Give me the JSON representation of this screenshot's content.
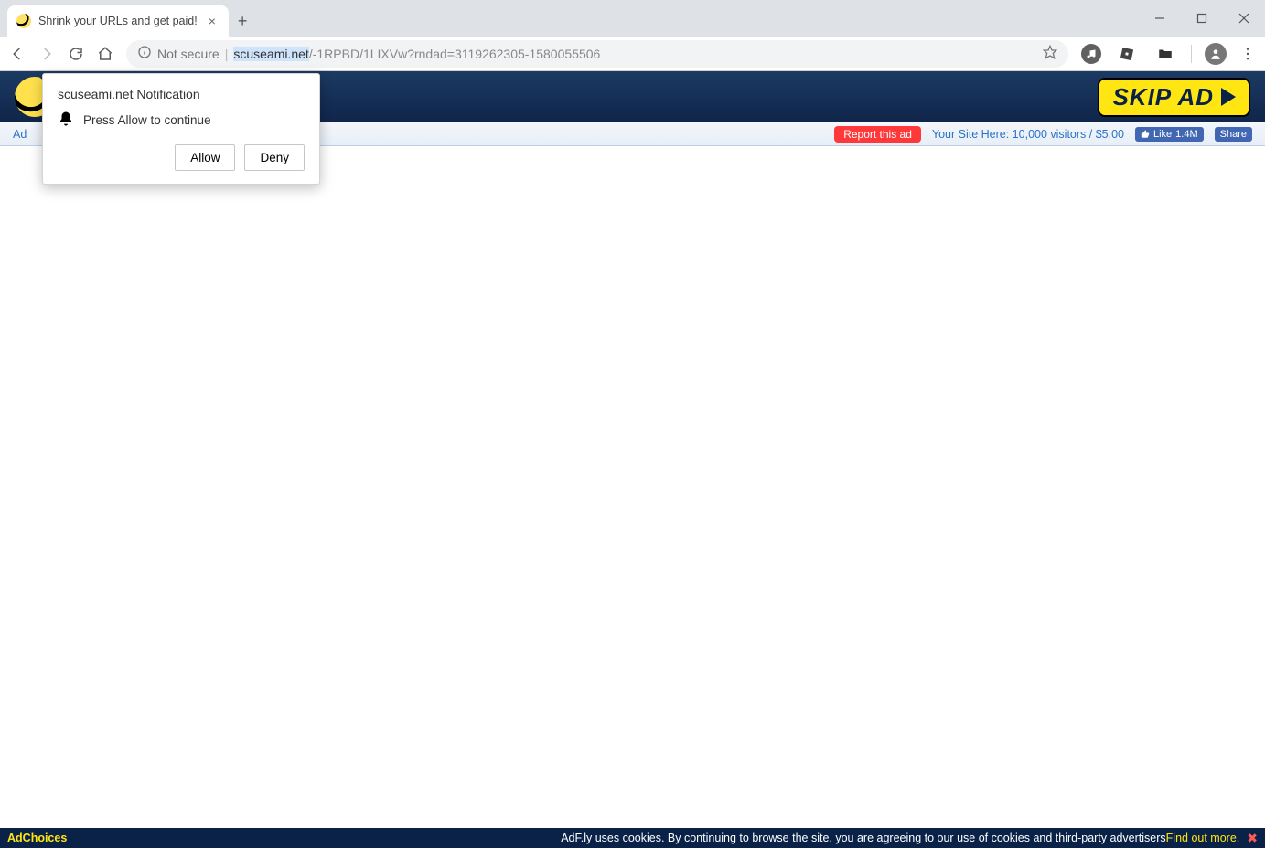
{
  "chrome": {
    "tab_title": "Shrink your URLs and get paid!",
    "new_tab": "+",
    "url_security": "Not secure",
    "url_host": "scuseami.net",
    "url_path": "/-1RPBD/1LIXVw?rndad=3119262305-1580055506"
  },
  "header": {
    "skip_label": "SKIP AD"
  },
  "subbar": {
    "left_text": "Ad",
    "report_label": "Report this ad",
    "site_here": "Your Site Here: 10,000 visitors / $5.00",
    "fb_like": "Like",
    "fb_count": "1.4M",
    "fb_share": "Share"
  },
  "notification": {
    "title": "scuseami.net Notification",
    "body": "Press Allow to continue",
    "allow": "Allow",
    "deny": "Deny"
  },
  "cookie": {
    "adchoices": "AdChoices",
    "text": "AdF.ly uses cookies. By continuing to browse the site, you are agreeing to our use of cookies and third-party advertisers ",
    "link": "Find out more",
    "period": "."
  }
}
